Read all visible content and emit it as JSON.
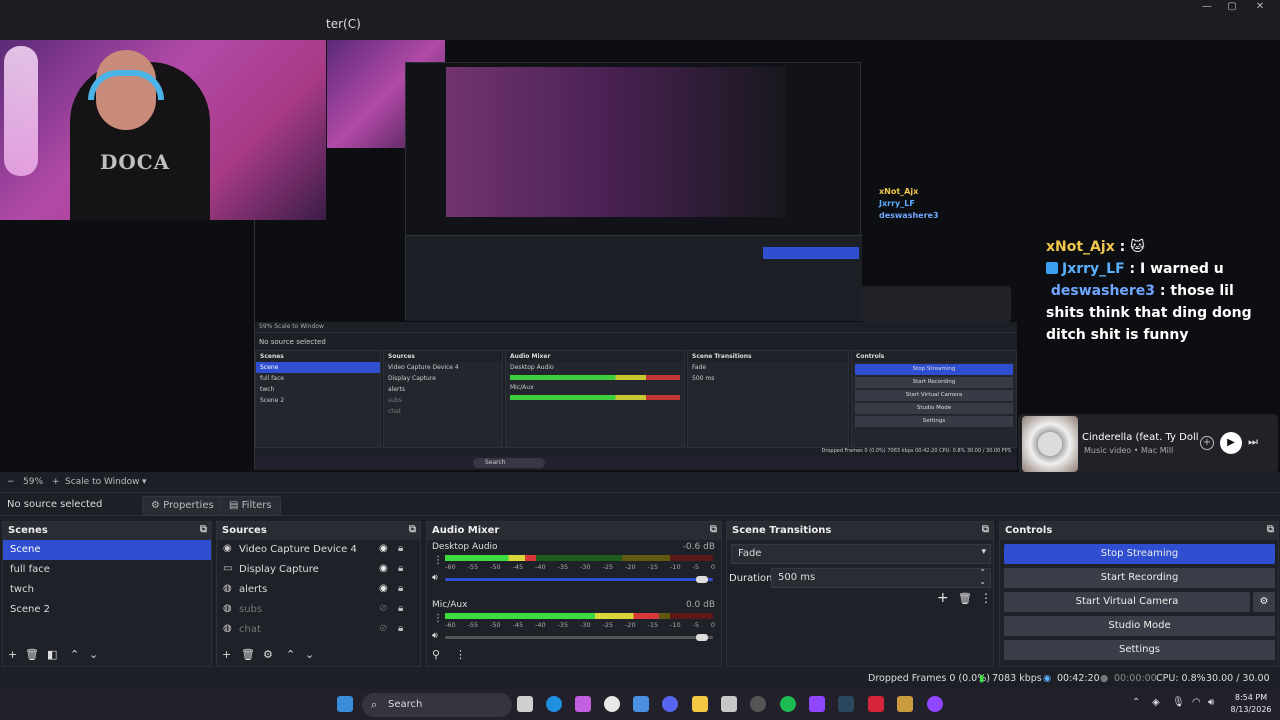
{
  "titlebar": {
    "title_fragment": "ter(C)"
  },
  "chat": {
    "messages": [
      {
        "user": "xNot_Ajx",
        "sep": " : ",
        "text": "🐱",
        "color": "#f0c74a"
      },
      {
        "user": "Jxrry_LF",
        "sep": " : ",
        "text": "I warned u",
        "color": "#5bb0ff"
      },
      {
        "user": "deswashere3",
        "sep": " : ",
        "text": "those lil shits think that ding dong ditch shit is funny",
        "color": "#6fa6ff"
      }
    ]
  },
  "music": {
    "title": "Cinderella (feat. Ty Doll",
    "subtitle": "Music video • Mac Mill"
  },
  "zoom": {
    "minus": "−",
    "level": "59%",
    "plus": "+",
    "scale_mode": "Scale to Window"
  },
  "source_bar": {
    "no_source": "No source selected",
    "properties": "Properties",
    "filters": "Filters"
  },
  "scenes": {
    "header": "Scenes",
    "items": [
      "Scene",
      "full face",
      "twch",
      "Scene 2"
    ],
    "selected": 0
  },
  "sources": {
    "header": "Sources",
    "items": [
      {
        "name": "Video Capture Device 4",
        "icon": "camera-icon",
        "visible": true
      },
      {
        "name": "Display Capture",
        "icon": "monitor-icon",
        "visible": true
      },
      {
        "name": "alerts",
        "icon": "globe-icon",
        "visible": true
      },
      {
        "name": "subs",
        "icon": "globe-icon",
        "visible": false
      },
      {
        "name": "chat",
        "icon": "globe-icon",
        "visible": false
      }
    ]
  },
  "audio_mixer": {
    "header": "Audio Mixer",
    "scale": [
      "-60",
      "-55",
      "-50",
      "-45",
      "-40",
      "-35",
      "-30",
      "-25",
      "-20",
      "-15",
      "-10",
      "-5",
      "0"
    ],
    "channels": [
      {
        "name": "Desktop Audio",
        "db": "-0.6 dB",
        "level": 0.34,
        "volume": 0.98
      },
      {
        "name": "Mic/Aux",
        "db": "0.0 dB",
        "level": 0.8,
        "volume": 0.98
      }
    ]
  },
  "scene_transitions": {
    "header": "Scene Transitions",
    "transition": "Fade",
    "duration_label": "Duration",
    "duration_value": "500 ms"
  },
  "controls": {
    "header": "Controls",
    "buttons": [
      "Stop Streaming",
      "Start Recording",
      "Start Virtual Camera",
      "Studio Mode",
      "Settings"
    ]
  },
  "status": {
    "dropped": "Dropped Frames 0 (0.0%)",
    "bitrate": "7083 kbps",
    "stream_time": "00:42:20",
    "rec_time": "00:00:00",
    "cpu": "CPU: 0.8%",
    "fps": "30.00 / 30.00 FPS"
  },
  "taskbar": {
    "search": "Search",
    "time": "8:54 PM",
    "date": "8/13/2026"
  },
  "mirror": {
    "zoom": "59%   Scale to Window",
    "no_source": "No source selected",
    "status": "Dropped Frames 0 (0.0%)   7083 kbps   00:42:20   CPU: 0.8%   30.00 / 30.00 FPS",
    "search": "Search"
  },
  "colors": {
    "accent": "#2f4fd0",
    "bg": "#1d1f26",
    "dock": "#1f2128"
  }
}
